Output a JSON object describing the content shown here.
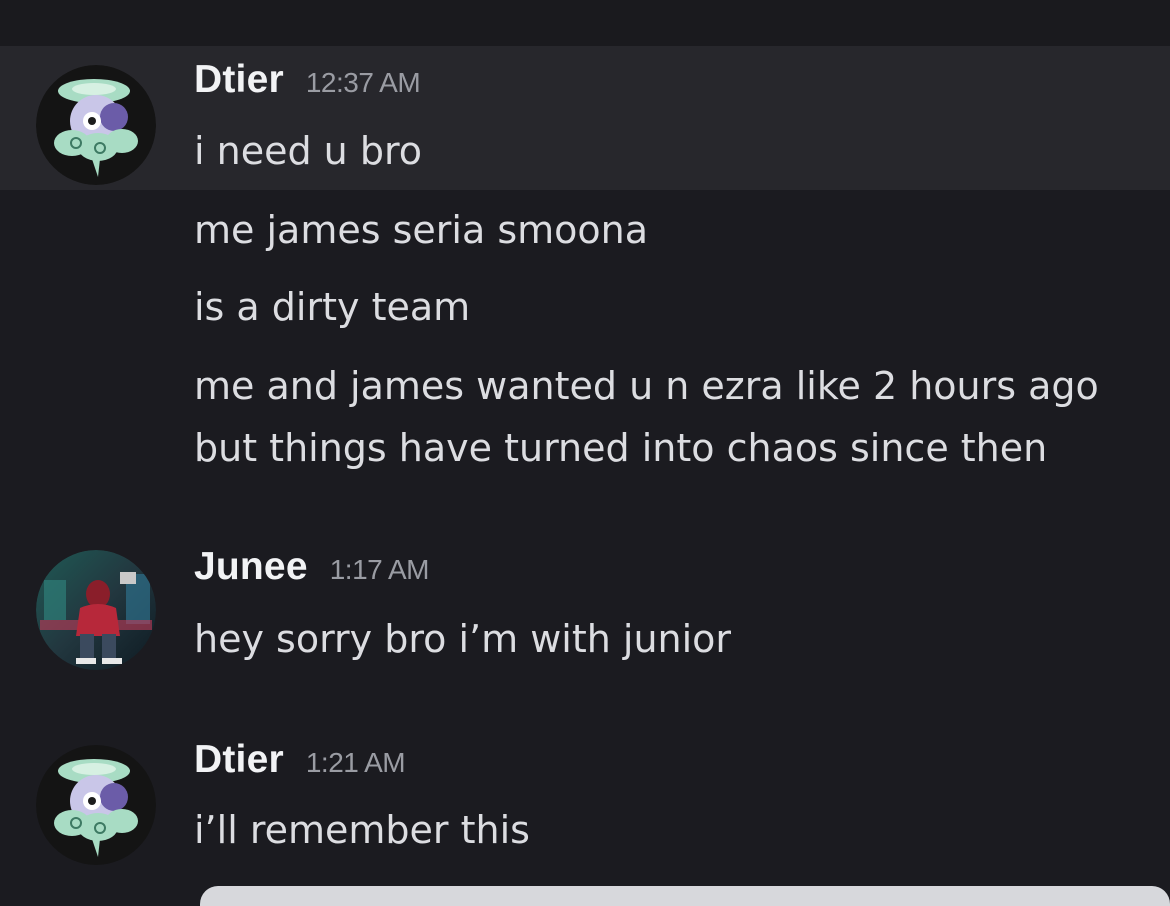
{
  "messages": [
    {
      "author": "Dtier",
      "time": "12:37 AM",
      "lines": [
        "i need u bro",
        "me james seria smoona",
        "is a dirty team",
        "me and james wanted u n ezra like 2 hours ago",
        "but things have turned into chaos since then"
      ]
    },
    {
      "author": "Junee",
      "time": "1:17 AM",
      "lines": [
        "hey sorry bro i’m with junior"
      ]
    },
    {
      "author": "Dtier",
      "time": "1:21 AM",
      "lines": [
        "i’ll remember this"
      ]
    }
  ],
  "avatars": {
    "dtier": "pokemon-castform-icon",
    "junee": "hooded-figure-city-art"
  },
  "colors": {
    "background": "#1b1b20",
    "highlight": "#27272c",
    "username": "#f2f3f5",
    "timestamp": "#9a9ca3",
    "message_text": "#dcdde1"
  }
}
